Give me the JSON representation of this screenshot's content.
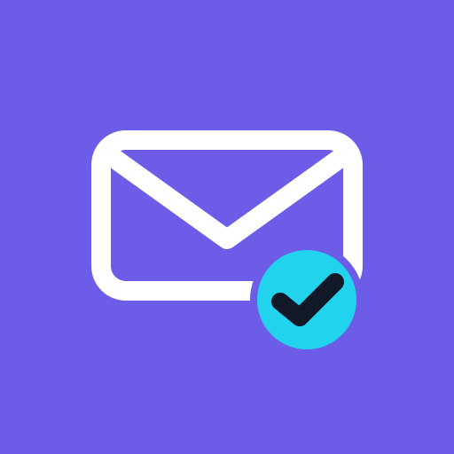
{
  "icon": {
    "name": "mail-verified-app-icon",
    "glyphs": [
      "envelope-icon",
      "check-badge-icon"
    ]
  },
  "colors": {
    "background": "#6C5CE7",
    "envelope_stroke": "#FFFFFF",
    "badge_fill": "#22D3EE",
    "check_stroke": "#111827"
  }
}
